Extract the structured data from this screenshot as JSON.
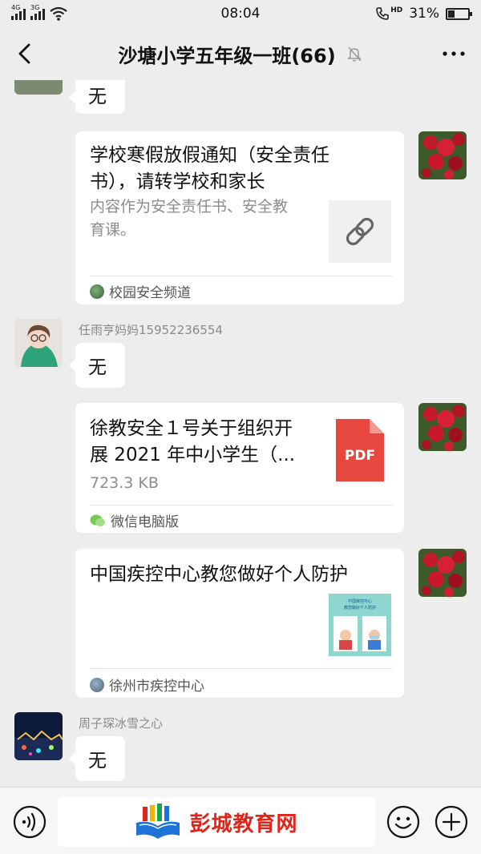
{
  "status_bar": {
    "network_left_1": "4G",
    "network_left_2": "3G",
    "time": "08:04",
    "hd_label": "HD",
    "battery_percent": "31%",
    "battery_level": 0.31
  },
  "header": {
    "title": "沙塘小学五年级一班(66)"
  },
  "messages": [
    {
      "type": "text",
      "side": "left",
      "text": "无"
    },
    {
      "type": "link_card",
      "side": "right",
      "title_lines": [
        "学校寒假放假通知（安全责任",
        "书），请转学校和家长"
      ],
      "desc_lines": [
        "内容作为安全责任书、安全教",
        "育课。"
      ],
      "source": "校园安全频道"
    },
    {
      "type": "text",
      "side": "left",
      "sender": "任雨亨妈妈15952236554",
      "text": "无"
    },
    {
      "type": "file_card",
      "side": "right",
      "title_lines": [
        "徐教安全１号关于组织开",
        "展 2021 年中小学生（..."
      ],
      "file_size": "723.3 KB",
      "file_type": "PDF",
      "source": "微信电脑版"
    },
    {
      "type": "article_card",
      "side": "right",
      "title": "中国疾控中心教您做好个人防护",
      "thumb_lines": [
        "中国疾控中心",
        "教您做好个人防护"
      ],
      "source": "徐州市疾控中心"
    },
    {
      "type": "text",
      "side": "left",
      "sender": "周子琛冰雪之心",
      "text": "无"
    }
  ],
  "input_bar": {
    "watermark_text": "彭城教育网"
  }
}
